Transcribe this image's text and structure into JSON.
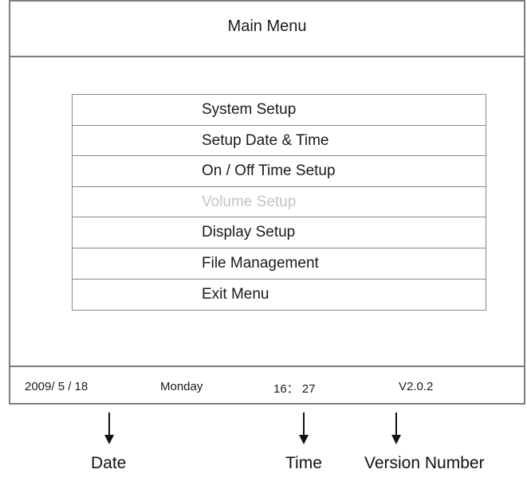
{
  "title": "Main Menu",
  "menu": {
    "items": [
      {
        "label": "System Setup",
        "disabled": false
      },
      {
        "label": "Setup Date & Time",
        "disabled": false
      },
      {
        "label": "On / Off Time Setup",
        "disabled": false
      },
      {
        "label": "Volume Setup",
        "disabled": true
      },
      {
        "label": "Display Setup",
        "disabled": false
      },
      {
        "label": "File Management",
        "disabled": false
      },
      {
        "label": "Exit Menu",
        "disabled": false
      }
    ]
  },
  "status": {
    "date": "2009/ 5 / 18",
    "day": "Monday",
    "time": "16： 27",
    "version": "V2.0.2"
  },
  "callouts": {
    "date": "Date",
    "time": "Time",
    "version": "Version Number"
  },
  "colors": {
    "frame": "#7d7d7d",
    "disabled_text": "#c4c4c4"
  }
}
